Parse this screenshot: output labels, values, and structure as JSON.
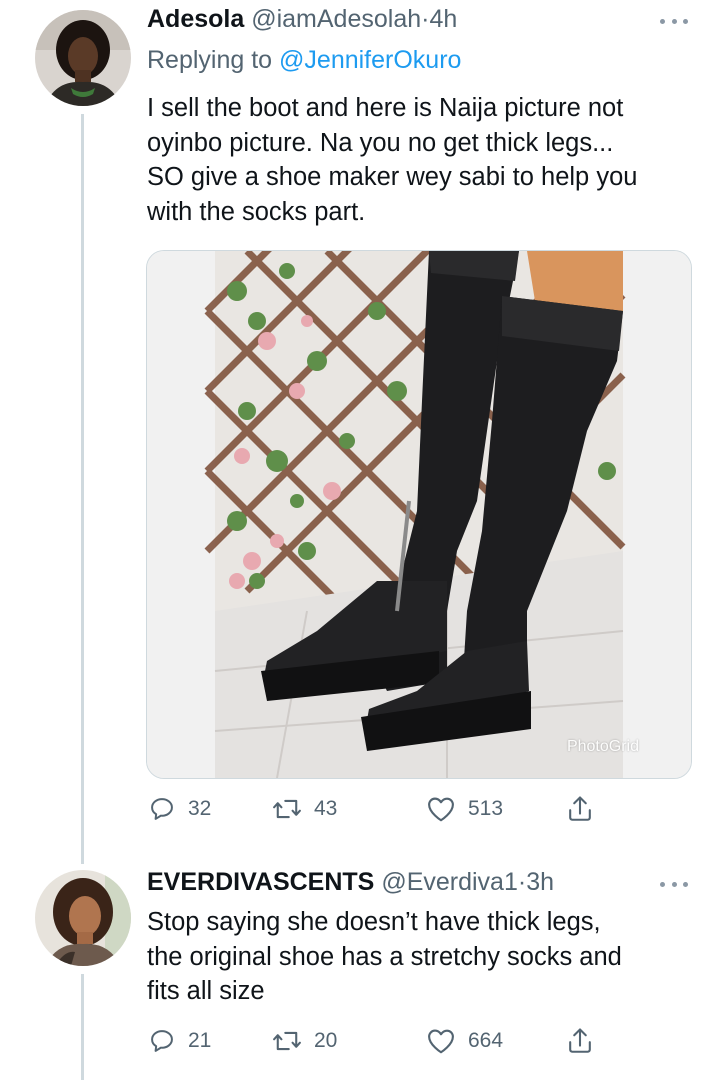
{
  "tweets": [
    {
      "display_name": "Adesola",
      "handle": "@iamAdesolah",
      "separator": "·",
      "time": "4h",
      "replying_prefix": "Replying to ",
      "replying_to": "@JenniferOkuro",
      "text_lines": [
        "I sell the boot and here is Naija picture not",
        "oyinbo picture. Na you no get thick legs...",
        "SO give a shoe maker wey sabi to help you",
        "with the socks part."
      ],
      "media": {
        "description_icon": "boots-photo",
        "watermark": "PhotoGrid"
      },
      "stats": {
        "replies": "32",
        "retweets": "43",
        "likes": "513"
      }
    },
    {
      "display_name": "EVERDIVASCENTS",
      "handle": "@Everdiva1",
      "separator": "·",
      "time": "3h",
      "text_lines": [
        "Stop saying she doesn’t have thick legs,",
        "the original shoe has a stretchy socks and",
        "fits all size"
      ],
      "stats": {
        "replies": "21",
        "retweets": "20",
        "likes": "664"
      }
    }
  ],
  "icons": {
    "reply": "reply-icon",
    "retweet": "retweet-icon",
    "like": "heart-icon",
    "share": "share-icon",
    "more": "more-dots-icon"
  },
  "colors": {
    "text": "#0f1419",
    "secondary": "#536471",
    "link": "#1d9bf0",
    "thread_line": "#cfd9de"
  }
}
